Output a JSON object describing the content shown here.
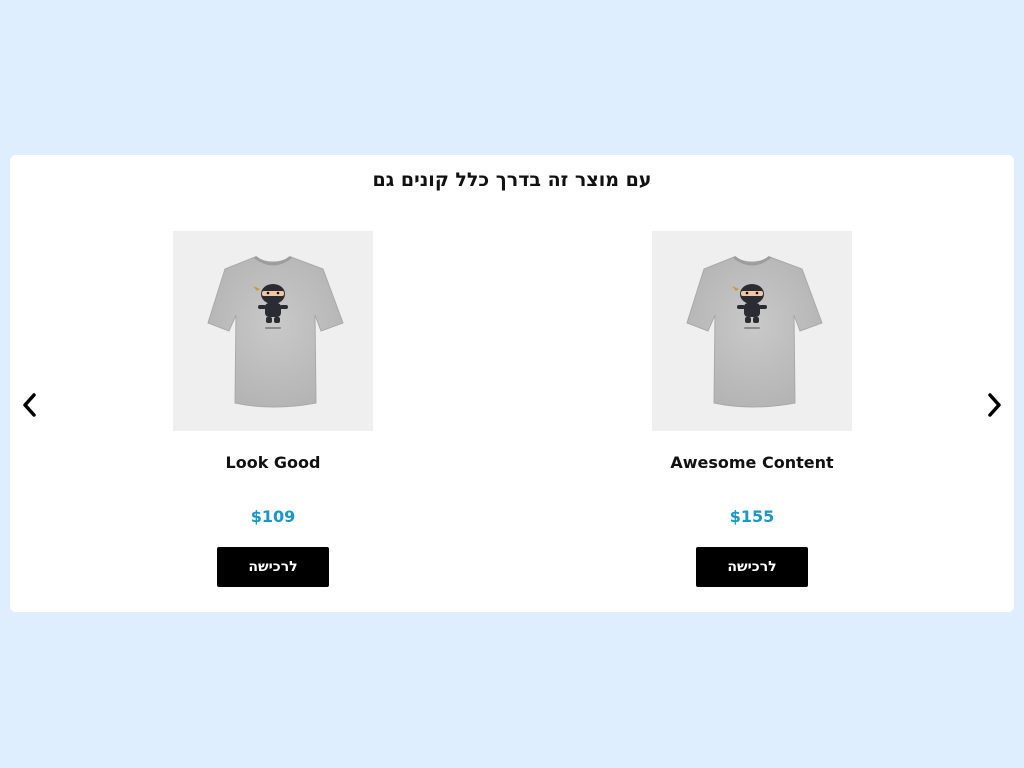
{
  "section": {
    "title": "עם מוצר זה בדרך כלל קונים גם"
  },
  "carousel": {
    "prev_icon": "chevron-left-icon",
    "next_icon": "chevron-right-icon"
  },
  "products": [
    {
      "name": "Look Good",
      "price": "$109",
      "button_label": "לרכישה",
      "image_icon": "ninja-tshirt-image"
    },
    {
      "name": "Awesome Content",
      "price": "$155",
      "button_label": "לרכישה",
      "image_icon": "ninja-tshirt-image"
    }
  ],
  "colors": {
    "background": "#deeefe",
    "card": "#ffffff",
    "price": "#1a96c9",
    "button": "#000000",
    "button_text": "#ffffff"
  }
}
